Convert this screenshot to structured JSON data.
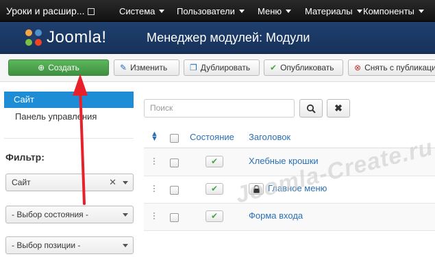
{
  "topbar": {
    "site_label": "Уроки и расшир...",
    "menus": [
      "Система",
      "Пользователи",
      "Меню",
      "Материалы",
      "Компоненты"
    ]
  },
  "header": {
    "logo_text": "Joomla!",
    "title": "Менеджер модулей: Модули"
  },
  "toolbar": {
    "create": "Создать",
    "edit": "Изменить",
    "duplicate": "Дублировать",
    "publish": "Опубликовать",
    "unpublish": "Снять с публикаци"
  },
  "sidebar": {
    "items": [
      "Сайт",
      "Панель управления"
    ],
    "selected": "Сайт"
  },
  "filter": {
    "label": "Фильтр:",
    "client_value": "Сайт",
    "state_placeholder": "- Выбор состояния -",
    "position_placeholder": "- Выбор позиции -"
  },
  "search": {
    "placeholder": "Поиск"
  },
  "table": {
    "headers": {
      "state": "Состояние",
      "title": "Заголовок"
    },
    "rows": [
      {
        "title": "Хлебные крошки",
        "published": true,
        "locked": false
      },
      {
        "title": "Главное меню",
        "published": true,
        "locked": true
      },
      {
        "title": "Форма входа",
        "published": true,
        "locked": false
      }
    ]
  },
  "watermark": "Joomla-Create.ru",
  "colors": {
    "topbar": "#1a1a1a",
    "header": "#1c3a66",
    "accent_blue": "#1f8dd6",
    "create_button": "#4aa54a",
    "link": "#2a6fb4",
    "annotation_arrow": "#e8202a"
  }
}
